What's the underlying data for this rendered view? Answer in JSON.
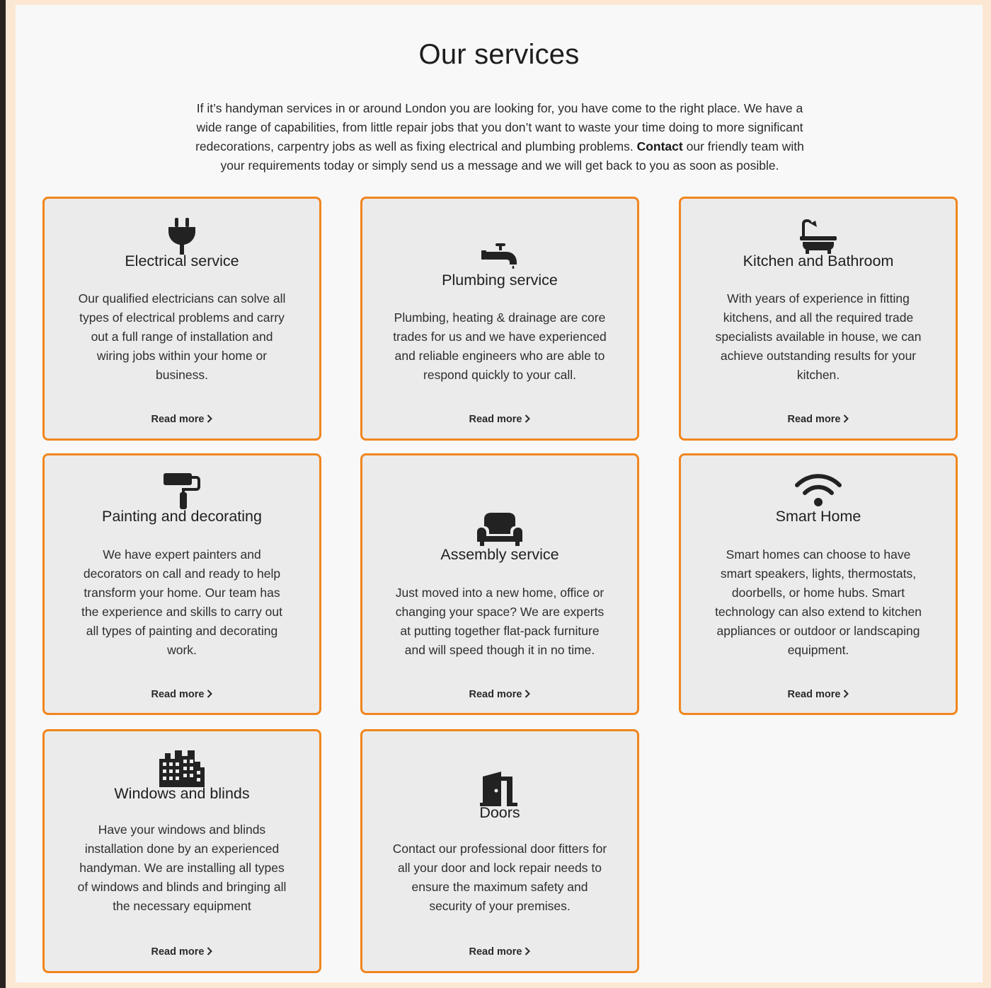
{
  "section": {
    "title": "Our services",
    "intro_part1": "If it’s handyman services in or around London you are looking for, you have come to the right place. We have a wide range of capabilities, from little repair jobs that you don’t want to waste your time doing to more significant redecorations, carpentry jobs as well as fixing electrical and plumbing problems. ",
    "intro_link": "Contact",
    "intro_part2": " our friendly team with your requirements today or simply send us a message and we will get back to you as soon as posible."
  },
  "colors": {
    "accent_border": "#f0861e",
    "card_background": "#ebebeb",
    "page_background": "#f8f8f8",
    "icon_color": "#222222"
  },
  "read_more_label": "Read more",
  "cards": [
    {
      "title": "Electrical service",
      "icon": "plug-icon",
      "description": "Our qualified electricians can solve all types of electrical problems and carry out a full range of installation and wiring jobs within your home or business."
    },
    {
      "title": "Plumbing service",
      "icon": "faucet-icon",
      "description": "Plumbing, heating & drainage are core trades for us and we have experienced and reliable engineers who are able to respond quickly to your call."
    },
    {
      "title": "Kitchen and Bathroom",
      "icon": "bath-icon",
      "description": "With years of experience in fitting kitchens, and all the required trade specialists available in house, we can achieve outstanding results for your kitchen."
    },
    {
      "title": "Painting and decorating",
      "icon": "paint-roller-icon",
      "description": "We have expert painters and decorators on call and ready to help transform your home. Our team has the experience and skills to carry out all types of painting and decorating work."
    },
    {
      "title": "Assembly service",
      "icon": "couch-icon",
      "description": "Just moved into a new home, office or changing your space? We are experts at putting together flat-pack furniture and will speed though it in no time."
    },
    {
      "title": "Smart Home",
      "icon": "wifi-icon",
      "description": "Smart homes can choose to have smart speakers, lights, thermostats, doorbells, or home hubs. Smart technology can also extend to kitchen appliances or outdoor or landscaping equipment."
    },
    {
      "title": "Windows and blinds",
      "icon": "building-windows-icon",
      "description": "Have your windows and blinds installation done by an experienced handyman. We are installing all types of windows and blinds and bringing all the necessary equipment"
    },
    {
      "title": "Doors",
      "icon": "door-icon",
      "description": "Contact our professional door fitters for all your door and lock repair needs to ensure the maximum safety and security of your premises."
    }
  ]
}
